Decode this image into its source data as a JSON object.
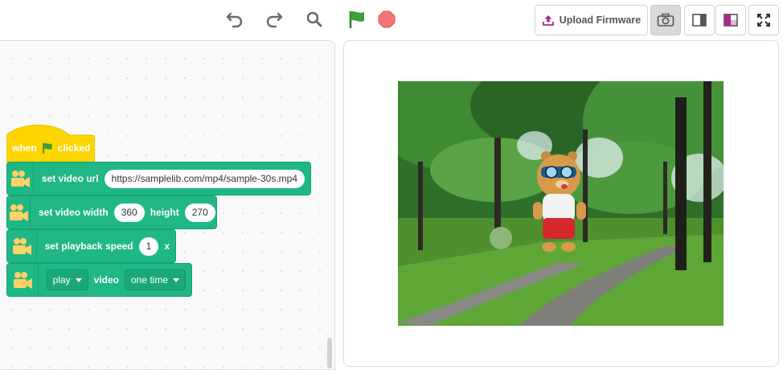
{
  "toolbar": {
    "undo_icon": "undo-icon",
    "redo_icon": "redo-icon",
    "zoom_icon": "magnifier-icon",
    "green_flag_icon": "green-flag-icon",
    "stop_icon": "stop-sign-icon",
    "upload_label": "Upload Firmware",
    "mode_buttons": [
      "camera-stage-mode",
      "small-stage-mode",
      "large-stage-mode",
      "fullscreen-mode"
    ]
  },
  "blocks": {
    "hat": {
      "when": "when",
      "clicked": "clicked",
      "flag_icon": "green-flag-icon"
    },
    "set_url": {
      "label": "set video url",
      "url": "https://samplelib.com/mp4/sample-30s.mp4"
    },
    "set_size": {
      "width_label": "set video width",
      "width": "360",
      "height_label": "height",
      "height": "270"
    },
    "set_speed": {
      "label": "set playback speed",
      "speed": "1",
      "suffix": "x"
    },
    "play": {
      "action": "play",
      "video_label": "video",
      "mode": "one time"
    }
  },
  "stage": {
    "scene": "park path with trees",
    "sprite": "bear-with-goggles"
  },
  "colors": {
    "motion_green": "#20b786",
    "event_yellow": "#ffd500",
    "flag_green": "#3d9e3a",
    "stop_red": "#f27474",
    "firmware_purple": "#a52a8c"
  }
}
